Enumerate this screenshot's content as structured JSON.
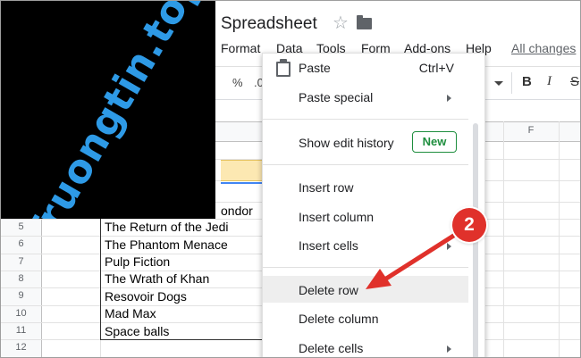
{
  "logo": {
    "text": "Truongtin.top"
  },
  "header": {
    "title": "Spreadsheet"
  },
  "menubar": {
    "items": [
      "Format",
      "Data",
      "Tools",
      "Form",
      "Add-ons",
      "Help"
    ],
    "all_changes": "All changes"
  },
  "toolbar": {
    "percent": "%",
    "decimal": ".0",
    "bold": "B",
    "italic": "I",
    "strike": "S"
  },
  "grid": {
    "column_header": "F",
    "row_numbers": [
      "5",
      "6",
      "7",
      "8",
      "9",
      "10",
      "11",
      "12"
    ],
    "cells": [
      "The Return of the Jedi",
      "The Phantom Menace",
      "Pulp Fiction",
      "The Wrath of Khan",
      "Resovoir Dogs",
      "Mad Max",
      "Space balls"
    ],
    "partial_cell": "ondor"
  },
  "context_menu": {
    "paste": "Paste",
    "paste_shortcut": "Ctrl+V",
    "paste_special": "Paste special",
    "show_edit_history": "Show edit history",
    "new_badge": "New",
    "insert_row": "Insert row",
    "insert_column": "Insert column",
    "insert_cells": "Insert cells",
    "delete_row": "Delete row",
    "delete_column": "Delete column",
    "delete_cells": "Delete cells"
  },
  "annotation": {
    "step": "2"
  },
  "colors": {
    "accent_green": "#1e8e3e",
    "callout_red": "#e0312b",
    "logo_blue": "#2e9ae6",
    "highlight_yellow": "#fce8b2"
  }
}
